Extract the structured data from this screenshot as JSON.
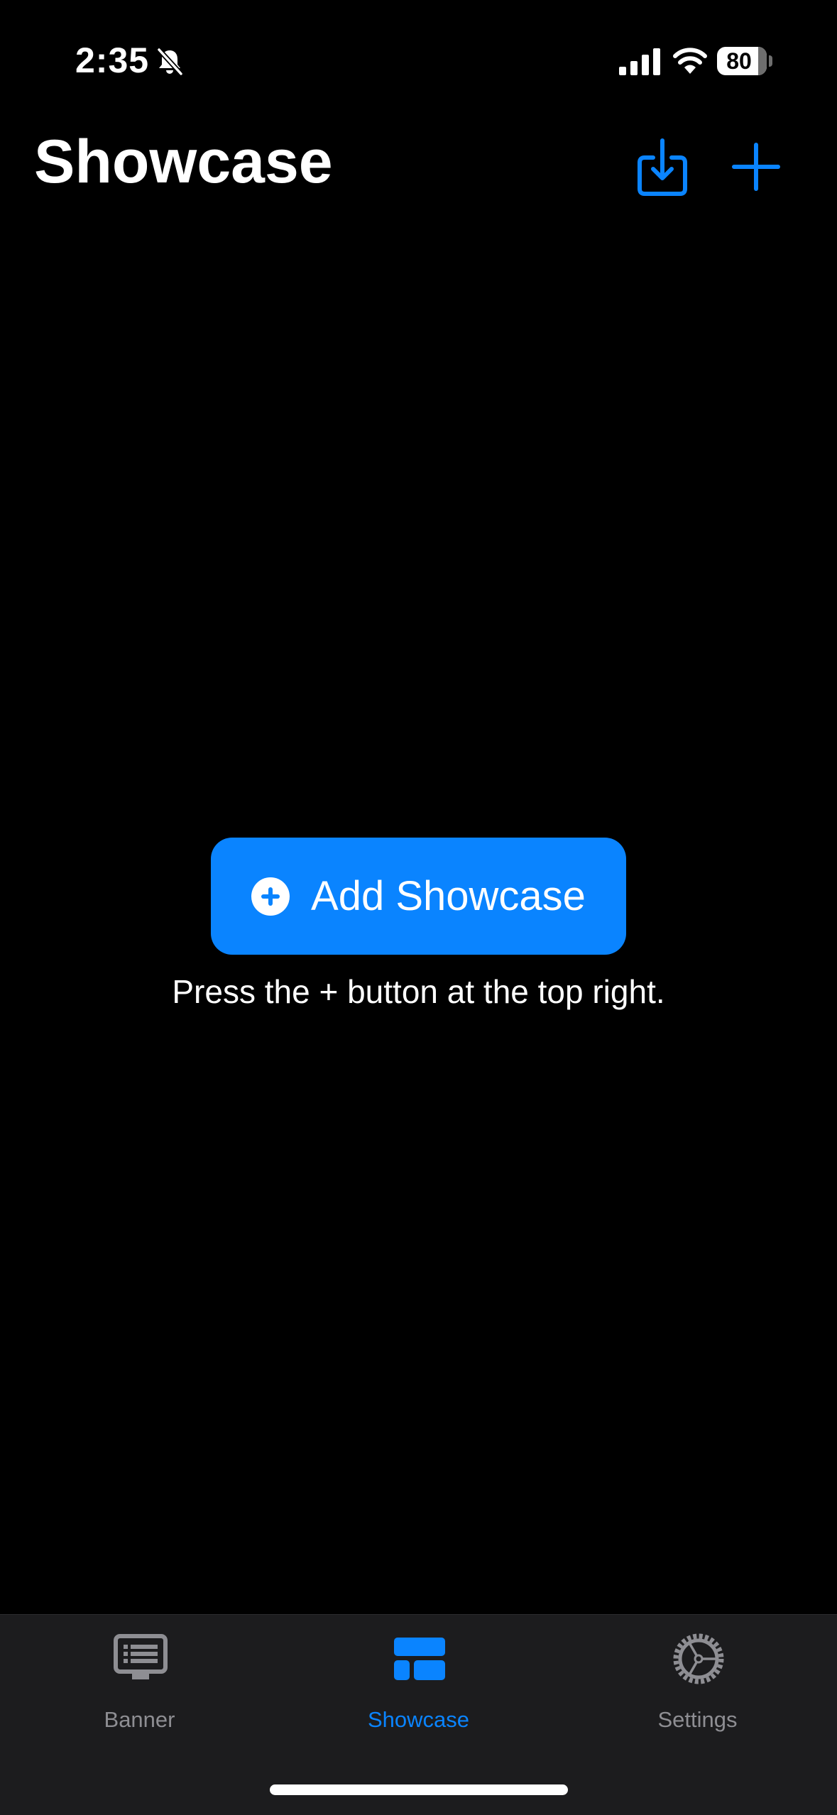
{
  "status_bar": {
    "time": "2:35",
    "battery_level": "80",
    "icons": [
      "bell-slash-icon",
      "signal-icon",
      "wifi-icon",
      "battery-icon"
    ]
  },
  "header": {
    "title": "Showcase",
    "import_icon": "tray-arrow-down-icon",
    "add_icon": "plus-icon"
  },
  "empty_state": {
    "button_label": "Add Showcase",
    "button_icon": "plus-circle-icon",
    "hint": "Press the + button at the top right."
  },
  "tab_bar": {
    "tabs": [
      {
        "label": "Banner",
        "icon": "display-icon",
        "active": false
      },
      {
        "label": "Showcase",
        "icon": "layout-icon",
        "active": true
      },
      {
        "label": "Settings",
        "icon": "gear-icon",
        "active": false
      }
    ]
  },
  "colors": {
    "background": "#000000",
    "accent": "#0a84ff",
    "tab_bar": "#1c1c1e",
    "inactive": "#8e8e93",
    "text": "#ffffff"
  }
}
